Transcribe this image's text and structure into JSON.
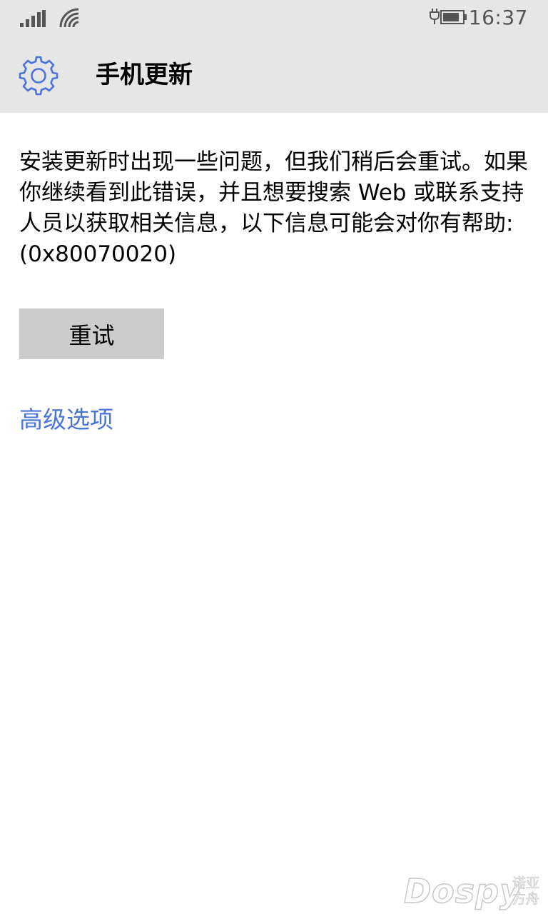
{
  "status_bar": {
    "time": "16:37",
    "icons": [
      "signal-icon",
      "wifi-icon",
      "battery-icon"
    ]
  },
  "header": {
    "icon": "gear-icon",
    "title": "手机更新"
  },
  "main": {
    "message": "安装更新时出现一些问题，但我们稍后会重试。如果你继续看到此错误，并且想要搜索 Web 或联系支持人员以获取相关信息，以下信息可能会对你有帮助: (0x80070020)",
    "retry_label": "重试",
    "advanced_link_label": "高级选项"
  },
  "watermark": {
    "brand": "Dospy",
    "sub_line1": "诺亚",
    "sub_line2": "方舟"
  },
  "colors": {
    "chrome_background": "#e6e6e6",
    "accent": "#4a74d8",
    "button_background": "#cccccc",
    "status_icon": "#555555"
  }
}
